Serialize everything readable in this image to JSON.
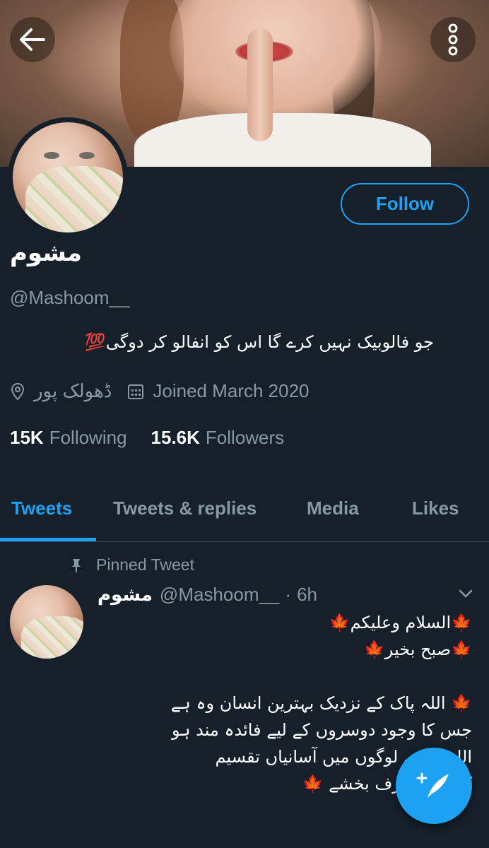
{
  "profile": {
    "name": "مشوم",
    "handle": "@Mashoom__",
    "bio": "جو فالوبیک نہیں کرے گا اس کو انفالو کر دوگی💯",
    "location": "ڈھولک پور",
    "joined": "Joined March 2020",
    "following_count": "15K",
    "following_label": "Following",
    "followers_count": "15.6K",
    "followers_label": "Followers"
  },
  "actions": {
    "follow_label": "Follow"
  },
  "tabs": [
    {
      "label": "Tweets",
      "active": true
    },
    {
      "label": "Tweets & replies",
      "active": false
    },
    {
      "label": "Media",
      "active": false
    },
    {
      "label": "Likes",
      "active": false
    }
  ],
  "pinned_tweet": {
    "pinned_label": "Pinned Tweet",
    "author_name": "مشوم",
    "author_handle": "@Mashoom__",
    "separator": "·",
    "time": "6h",
    "lines": [
      "🍁السلام وعلیکم🍁",
      "🍁صبح بخیر🍁",
      "🍁 اللہ پاک کے نزدیک بہترین انسان وہ ہے",
      "جس کا وجود دوسروں کے لیے فائدہ مند ہو",
      "اللہ ہمیں لوگوں میں آسانیاں تقسیم",
      "کرنے کا شرف بخشے 🍁"
    ]
  },
  "icons": {
    "back": "back-arrow-icon",
    "more": "more-vertical-icon",
    "location": "location-pin-icon",
    "calendar": "calendar-icon",
    "pin": "pin-icon",
    "caret": "chevron-down-icon",
    "compose": "compose-tweet-icon"
  },
  "colors": {
    "background": "#15202b",
    "accent": "#1da1f2",
    "secondary_text": "#8899a6",
    "divider": "#38444d"
  }
}
